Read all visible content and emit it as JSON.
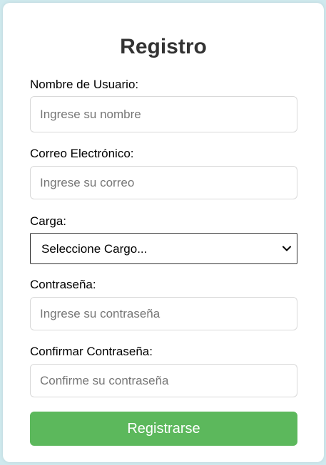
{
  "form": {
    "title": "Registro",
    "username": {
      "label": "Nombre de Usuario:",
      "placeholder": "Ingrese su nombre"
    },
    "email": {
      "label": "Correo Electrónico:",
      "placeholder": "Ingrese su correo"
    },
    "role": {
      "label": "Carga:",
      "selected": "Seleccione Cargo..."
    },
    "password": {
      "label": "Contraseña:",
      "placeholder": "Ingrese su contraseña"
    },
    "confirm_password": {
      "label": "Confirmar Contraseña:",
      "placeholder": "Confirme su contraseña"
    },
    "submit_label": "Registrarse"
  },
  "colors": {
    "background": "#cfe9ee",
    "card": "#ffffff",
    "submit": "#5cb85c",
    "title": "#333333"
  },
  "icons": {
    "select_chevron": "chevron-down-icon"
  }
}
